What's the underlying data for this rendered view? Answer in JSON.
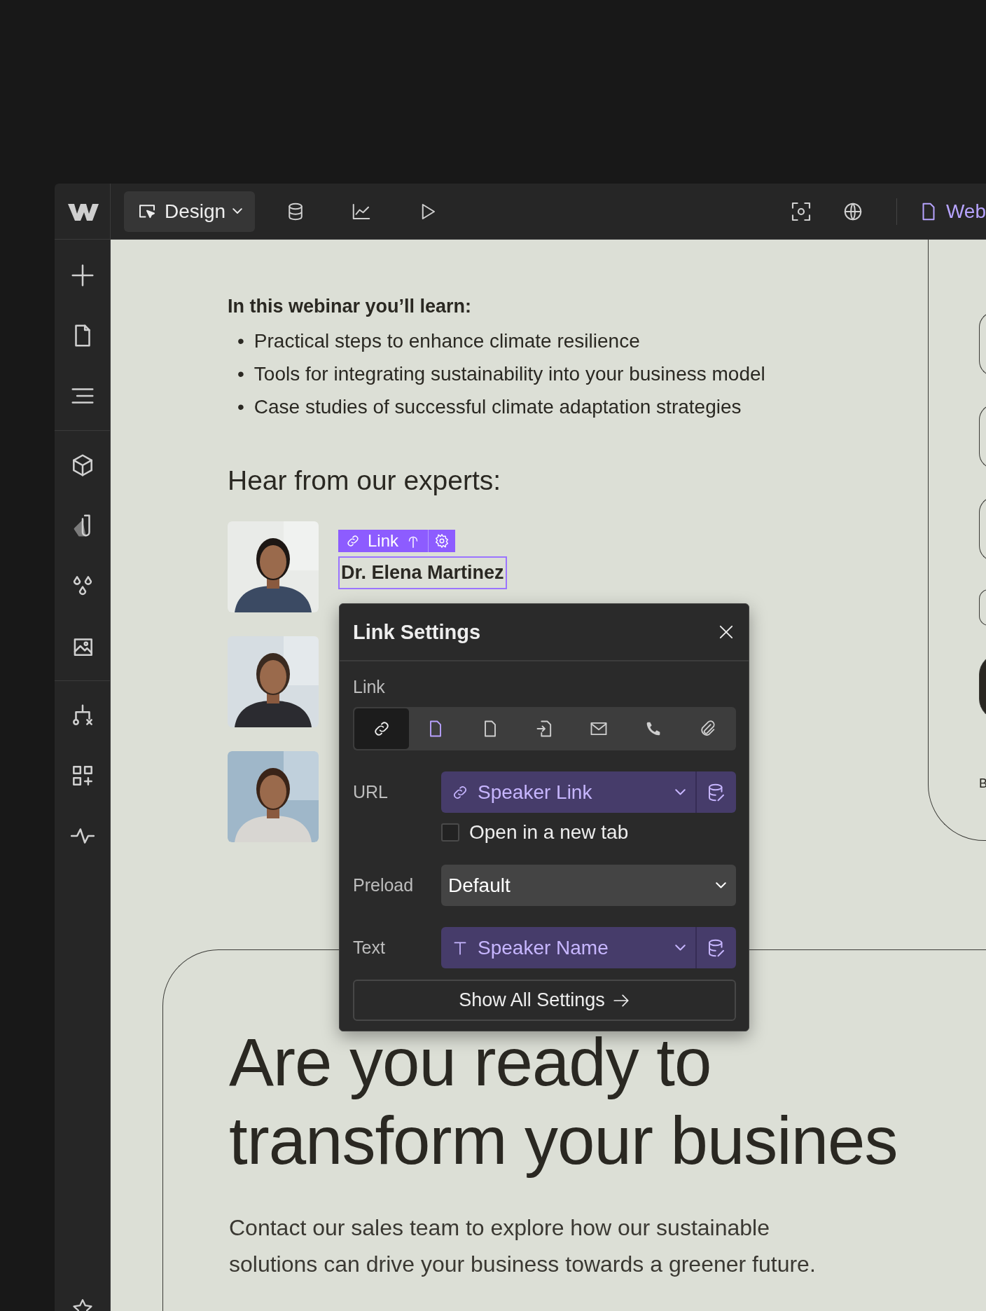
{
  "toolbar": {
    "mode_button": "Design",
    "page_label": "Web"
  },
  "content": {
    "learn_heading": "In this webinar you’ll learn:",
    "bullets": [
      {
        "marker": "•",
        "text": "Practical steps to enhance climate resilience"
      },
      {
        "marker": "•",
        "text": "Tools for integrating sustainability into your business model"
      },
      {
        "marker": "•",
        "text": "Case studies of successful climate adaptation strategies"
      }
    ],
    "experts_heading": "Hear from our experts:",
    "selected_element": {
      "tag_label": "Link",
      "name": "Dr. Elena Martinez"
    }
  },
  "link_settings": {
    "title": "Link Settings",
    "link_label": "Link",
    "link_types": [
      {
        "kind": "url",
        "selected": true,
        "accent": false
      },
      {
        "kind": "page",
        "selected": false,
        "accent": true
      },
      {
        "kind": "page",
        "selected": false,
        "accent": false
      },
      {
        "kind": "section",
        "selected": false,
        "accent": false
      },
      {
        "kind": "email",
        "selected": false,
        "accent": false
      },
      {
        "kind": "phone",
        "selected": false,
        "accent": false
      },
      {
        "kind": "file",
        "selected": false,
        "accent": false
      }
    ],
    "url": {
      "label": "URL",
      "value": "Speaker Link"
    },
    "new_tab": {
      "label": "Open in a new tab",
      "checked": false
    },
    "preload": {
      "label": "Preload",
      "value": "Default"
    },
    "text": {
      "label": "Text",
      "value": "Speaker Name"
    },
    "show_all": "Show All Settings"
  },
  "side_card": {
    "label": "B"
  },
  "cta": {
    "heading_lines": [
      "Are you ready to",
      "transform your busines"
    ],
    "body_lines": [
      "Contact our sales team to explore how our sustainable",
      "solutions can drive your business towards a greener future."
    ]
  }
}
